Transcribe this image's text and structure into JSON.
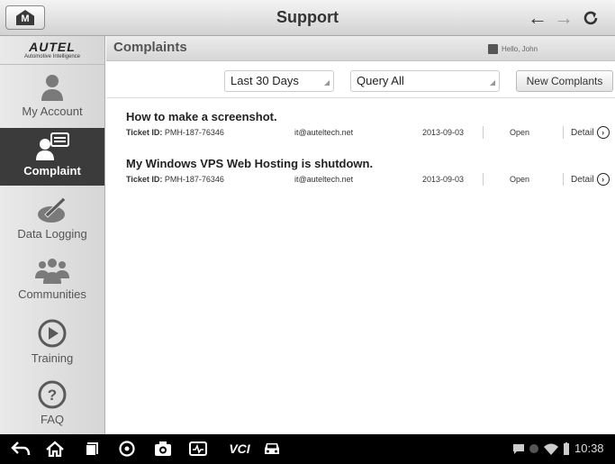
{
  "app": {
    "title": "Support",
    "home_label": "M"
  },
  "sidebar": {
    "logo": {
      "brand": "AUTEL",
      "tagline": "Automotive Intelligence"
    },
    "items": [
      {
        "label": "My Account",
        "icon": "person-icon",
        "active": false
      },
      {
        "label": "Complaint",
        "icon": "complaint-icon",
        "active": true
      },
      {
        "label": "Data Logging",
        "icon": "data-logging-icon",
        "active": false
      },
      {
        "label": "Communities",
        "icon": "communities-icon",
        "active": false
      },
      {
        "label": "Training",
        "icon": "play-icon",
        "active": false
      },
      {
        "label": "FAQ",
        "icon": "question-icon",
        "active": false
      }
    ]
  },
  "header": {
    "title": "Complaints",
    "greeting": "Hello, John"
  },
  "filters": {
    "period": "Last 30 Days",
    "query": "Query All",
    "new_button": "New Complants"
  },
  "tickets": [
    {
      "title": "How to make a screenshot.",
      "id_label": "Ticket ID:",
      "id": "PMH-187-76346",
      "email": "it@auteltech.net",
      "date": "2013-09-03",
      "status": "Open",
      "detail": "Detail"
    },
    {
      "title": "My Windows VPS Web Hosting is shutdown.",
      "id_label": "Ticket ID:",
      "id": "PMH-187-76346",
      "email": "it@auteltech.net",
      "date": "2013-09-03",
      "status": "Open",
      "detail": "Detail"
    }
  ],
  "statusbar": {
    "clock": "10:38",
    "vci_label": "VCI"
  },
  "colors": {
    "active_nav": "#3b3b3b",
    "statusbar": "#000000"
  }
}
